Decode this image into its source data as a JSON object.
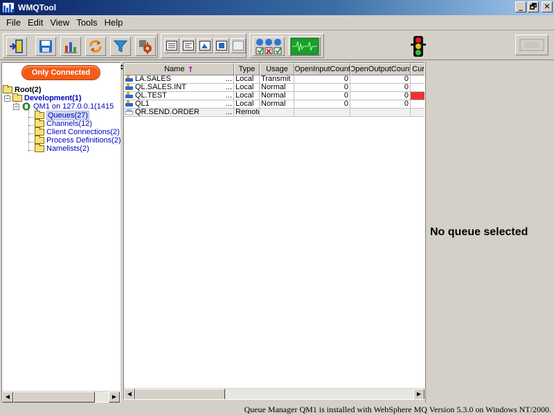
{
  "window": {
    "title": "WMQTool",
    "controls": {
      "minimize": "_",
      "maximize": "🗗",
      "close": "✕"
    }
  },
  "menubar": {
    "items": [
      "File",
      "Edit",
      "View",
      "Tools",
      "Help"
    ]
  },
  "toolbar": {
    "icons": [
      "exit-door-icon",
      "save-icon",
      "chart-icon",
      "refresh-icon",
      "filter-icon",
      "settings-gear-icon",
      "view-list-icon",
      "view-details-icon",
      "view-chart-icon",
      "view-properties-icon",
      "view-blank-icon",
      "status-lights-icon",
      "monitor-wave-icon",
      "traffic-light-icon",
      "console-icon"
    ]
  },
  "left_panel": {
    "filter_button": "Only Connected",
    "tree": {
      "root": "Root(2)",
      "development": "Development(1)",
      "qmgr": "QM1  on 127.0.0.1(1415",
      "queues": "Queues(27)",
      "channels": "Channels(12)",
      "client_connections": "Client Connections(2)",
      "process_definitions": "Process Definitions(2)",
      "namelists": "Namelists(2)"
    }
  },
  "table": {
    "columns": [
      {
        "label": "Name",
        "sorted": "↑"
      },
      {
        "label": "Type"
      },
      {
        "label": "Usage"
      },
      {
        "label": "OpenInputCount"
      },
      {
        "label": "OpenOutputCount"
      },
      {
        "label": "Cur"
      }
    ],
    "rows": [
      {
        "name": "LA.SALES",
        "type": "Local",
        "usage": "Transmit",
        "open_input": "0",
        "open_output": "0",
        "cur": "",
        "ellipsis": "...",
        "icon": "local-queue-icon"
      },
      {
        "name": "QL.SALES.INT",
        "type": "Local",
        "usage": "Normal",
        "open_input": "0",
        "open_output": "0",
        "cur": "",
        "ellipsis": "...",
        "icon": "local-queue-icon"
      },
      {
        "name": "QL.TEST",
        "type": "Local",
        "usage": "Normal",
        "open_input": "0",
        "open_output": "0",
        "cur": "",
        "ellipsis": "...",
        "icon": "local-queue-icon"
      },
      {
        "name": "QL1",
        "type": "Local",
        "usage": "Normal",
        "open_input": "0",
        "open_output": "0",
        "cur": "",
        "ellipsis": "...",
        "icon": "local-queue-icon"
      },
      {
        "name": "QR.SEND.ORDER",
        "type": "Remote",
        "usage": "",
        "open_input": "",
        "open_output": "",
        "cur": "",
        "ellipsis": "...",
        "icon": "remote-queue-icon"
      }
    ],
    "alert_color": "#ee3333"
  },
  "right_panel": {
    "message": "No queue selected"
  },
  "statusbar": {
    "text": "Queue Manager QM1  is installed with WebSphere MQ Version 5.3.0 on Windows NT/2000."
  }
}
